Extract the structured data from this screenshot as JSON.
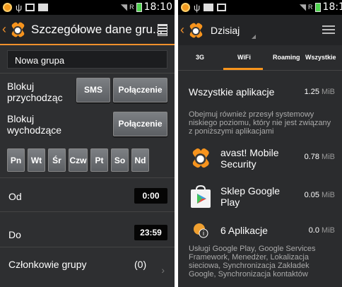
{
  "left": {
    "status_bar": {
      "time": "18:10",
      "signal": "R"
    },
    "action_bar": {
      "title": "Szczegółowe dane gru..."
    },
    "group_name": "Nowa grupa",
    "block_incoming": {
      "label_line1": "Blokuj",
      "label_line2": "przychodząc",
      "sms_button": "SMS",
      "call_button": "Połączenie"
    },
    "block_outgoing": {
      "label_line1": "Blokuj",
      "label_line2": "wychodzące",
      "call_button": "Połączenie"
    },
    "days": [
      "Pn",
      "Wt",
      "Śr",
      "Czw",
      "Pt",
      "So",
      "Nd"
    ],
    "from": {
      "label": "Od",
      "value": "0:00"
    },
    "to": {
      "label": "Do",
      "value": "23:59"
    },
    "members": {
      "label": "Członkowie grupy",
      "count": "(0)"
    }
  },
  "right": {
    "status_bar": {
      "time": "18:1",
      "signal": "R"
    },
    "action_bar": {
      "dropdown": "Dzisiaj"
    },
    "tabs": [
      "3G",
      "WiFi",
      "Roaming",
      "Wszystkie"
    ],
    "active_tab": "WiFi",
    "all_apps": {
      "label": "Wszystkie aplikacje",
      "size": "1.25",
      "unit": "MiB"
    },
    "description": "Obejmuj również przesył systemowy niskiego poziomu, który nie jest związany z poniższymi aplikacjami",
    "apps": [
      {
        "name_line1": "avast! Mobile",
        "name_line2": "Security",
        "size": "0.78",
        "unit": "MiB",
        "icon": "avast-logo-icon"
      },
      {
        "name_line1": "Sklep Google",
        "name_line2": "Play",
        "size": "0.05",
        "unit": "MiB",
        "icon": "google-play-icon"
      },
      {
        "name_line1": "6 Aplikacje",
        "name_line2": "",
        "size": "0.0",
        "unit": "MiB",
        "icon": "globe-apps-icon"
      }
    ],
    "footer": "Usługi Google Play, Google Services Framework, Menedżer, Lokalizacja sieciowa, Synchronizacja Zakładek Google, Synchronizacja kontaktów"
  },
  "colors": {
    "accent": "#f7941d",
    "background": "#2e2f31"
  }
}
